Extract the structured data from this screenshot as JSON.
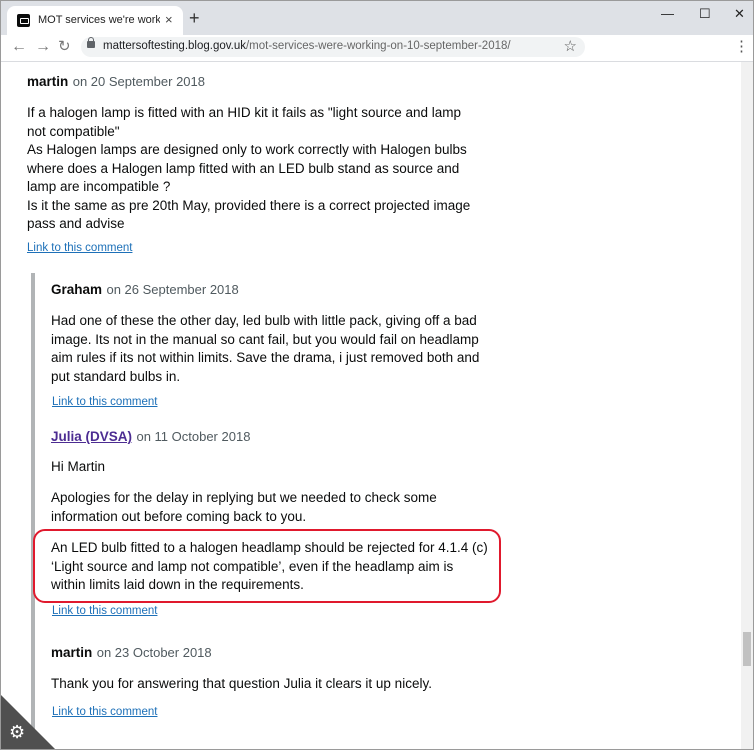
{
  "browser": {
    "tab_title": "MOT services we're working on",
    "tab_close": "×",
    "new_tab": "+",
    "url_host": "mattersoftesting.blog.gov.uk",
    "url_path": "/mot-services-were-working-on-10-september-2018/",
    "minimize": "—",
    "maximize": "☐",
    "close": "✕"
  },
  "comments": [
    {
      "author": "martin",
      "date": "on 20 September 2018",
      "paragraphs": [
        "If a halogen lamp is fitted with an HID kit it fails as \"light source and lamp not compatible\"\nAs Halogen lamps are designed only to work correctly with Halogen bulbs where does a Halogen lamp fitted with an LED bulb stand as source and lamp are incompatible ?\nIs it the same as pre 20th May, provided there is a correct projected image pass and advise"
      ],
      "link": "Link to this comment"
    },
    {
      "author": "Graham",
      "date": "on 26 September 2018",
      "paragraphs": [
        "Had one of these the other day, led bulb with little pack, giving off a bad image. Its not in the manual so cant fail, but you would fail on headlamp aim rules if its not within limits. Save the drama, i just removed both and put standard bulbs in."
      ],
      "link": "Link to this comment"
    },
    {
      "author": "Julia (DVSA)",
      "date": "on 11 October 2018",
      "paragraphs": [
        "Hi Martin",
        "Apologies for the delay in replying but we needed to check some information out before coming back to you.",
        "An LED bulb fitted to a halogen headlamp should be rejected for 4.1.4 (c) ‘Light source and lamp not compatible’, even if the headlamp aim is within limits laid down in the requirements."
      ],
      "link": "Link to this comment"
    },
    {
      "author": "martin",
      "date": "on 23 October 2018",
      "paragraphs": [
        "Thank you for answering that question Julia it clears it up nicely."
      ],
      "link": "Link to this comment"
    }
  ],
  "colors": {
    "link": "#1d70b8",
    "staff_author": "#4c2c92",
    "highlight_border": "#e0192d"
  }
}
